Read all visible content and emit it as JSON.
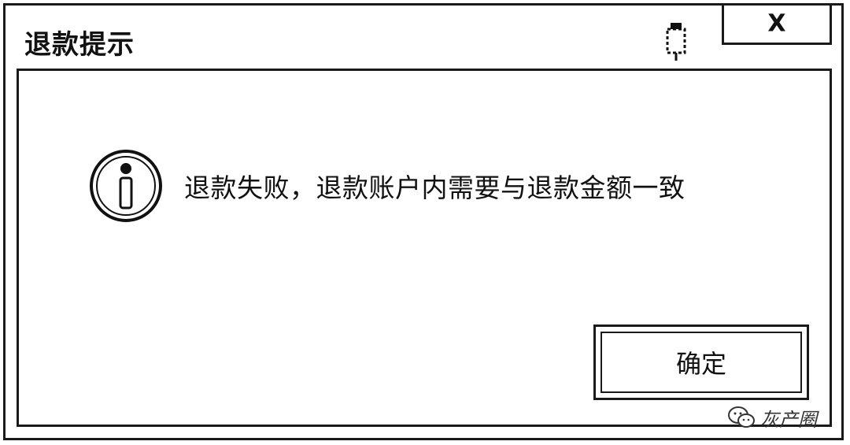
{
  "dialog": {
    "title": "退款提示",
    "close_label": "X",
    "message": "退款失败，退款账户内需要与退款金额一致",
    "ok_label": "确定",
    "watermark_text": "灰产圈"
  },
  "icons": {
    "info": "info-icon",
    "pin": "pin-icon",
    "close": "close-icon",
    "wechat": "wechat-icon"
  },
  "colors": {
    "border": "#1a1a1a",
    "background": "#ffffff",
    "text": "#111111"
  }
}
